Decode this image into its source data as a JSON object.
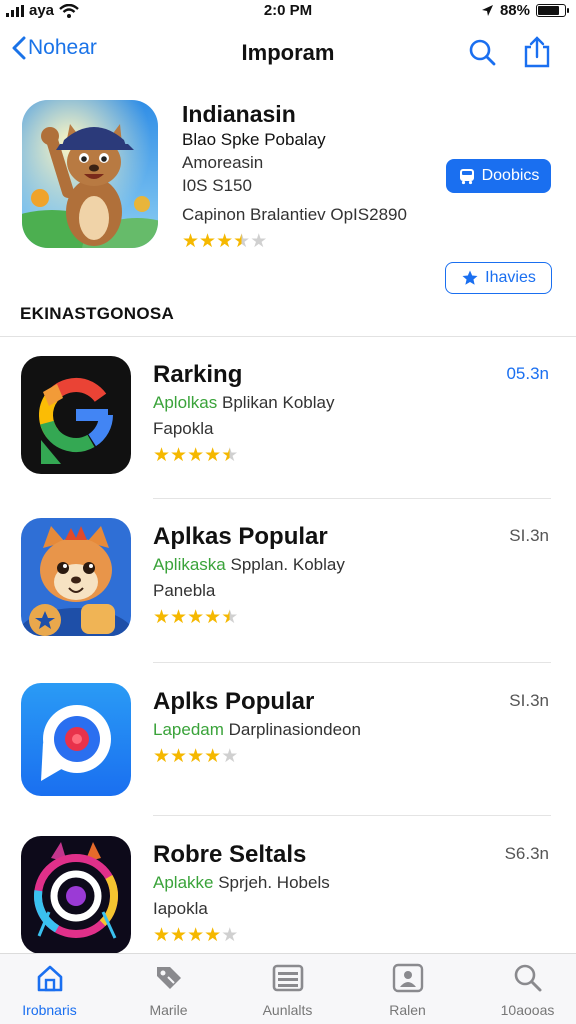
{
  "status_bar": {
    "carrier": "aya",
    "time": "2:0 PM",
    "battery": "88%",
    "battery_level": 0.88
  },
  "nav": {
    "back_label": "Nohear",
    "title": "Imporam"
  },
  "featured": {
    "title": "Indianasin",
    "subtitle": "Blao Spke Pobalay",
    "line1": "Amoreasin",
    "line2": "I0S S150",
    "line3": "Capinon Bralantiev OpIS2890",
    "rating": 3.5,
    "primary_button": "Doobics",
    "secondary_button": "Ihavies"
  },
  "section_heading": "EKINASTGONOSA",
  "apps": [
    {
      "name": "Rarking",
      "green": "Aplolkas",
      "subtitle": "Bplikan Koblay",
      "line2": "Fapokla",
      "meta": "05.3n",
      "rating": 4.5,
      "icon": "google-style-g-icon"
    },
    {
      "name": "Aplkas Popular",
      "green": "Aplikaska",
      "subtitle": "Spplan. Koblay",
      "line2": "Panebla",
      "meta": "SI.3n",
      "rating": 4.5,
      "icon": "cat-mascot-icon"
    },
    {
      "name": "Aplks Popular",
      "green": "Lapedam",
      "subtitle": "Darplinasiondeon",
      "line2": "",
      "meta": "SI.3n",
      "rating": 4,
      "icon": "chat-bubble-icon"
    },
    {
      "name": "Robre Seltals",
      "green": "Aplakke",
      "subtitle": "Sprjeh. Hobels",
      "line2": "Iapokla",
      "meta": "S6.3n",
      "rating": 4,
      "icon": "neon-ring-icon"
    }
  ],
  "tabs": [
    {
      "label": "Irobnaris",
      "icon": "house-icon",
      "active": true
    },
    {
      "label": "Marile",
      "icon": "tag-icon",
      "active": false
    },
    {
      "label": "Aunlalts",
      "icon": "stack-icon",
      "active": false
    },
    {
      "label": "Ralen",
      "icon": "image-frame-icon",
      "active": false
    },
    {
      "label": "10aooas",
      "icon": "search-icon",
      "active": false
    }
  ],
  "colors": {
    "accent": "#1a6ff0",
    "star": "#f5b800",
    "green_text": "#3aa33a"
  }
}
